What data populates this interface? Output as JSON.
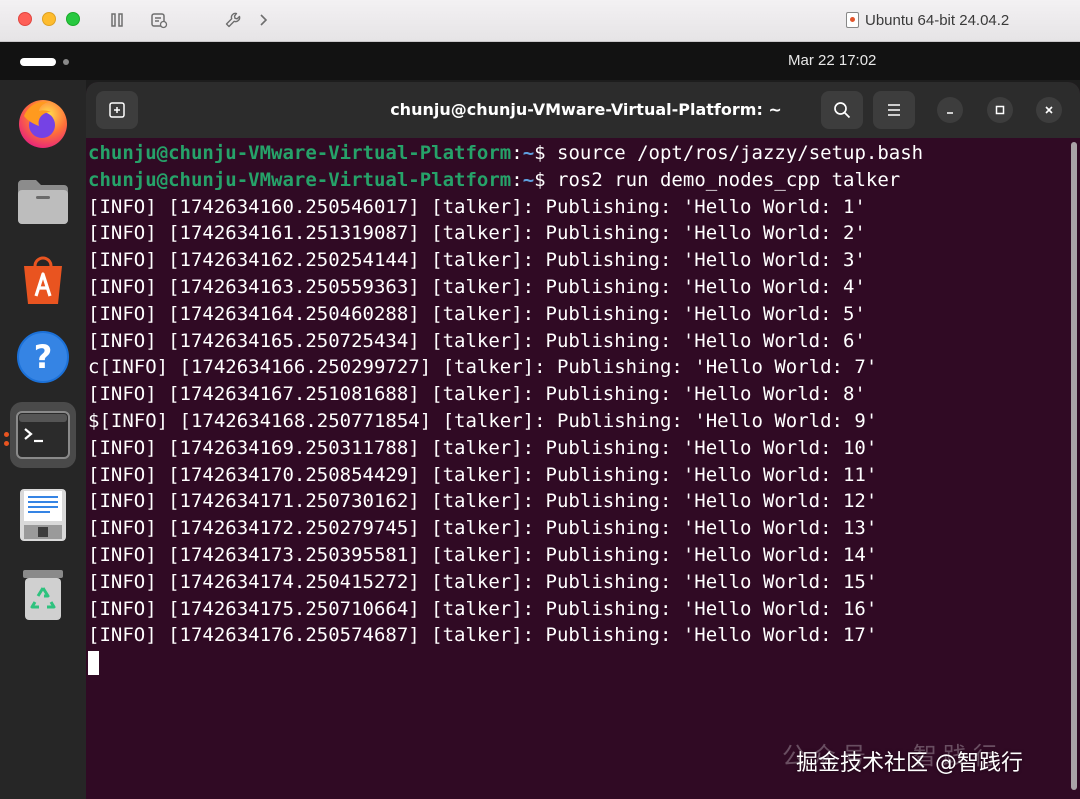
{
  "host": {
    "title": "Ubuntu 64-bit 24.04.2"
  },
  "topbar": {
    "clock": "Mar 22  17:02"
  },
  "terminal": {
    "title": "chunju@chunju-VMware-Virtual-Platform: ~",
    "prompt_user": "chunju@chunju-VMware-Virtual-Platform",
    "prompt_path": "~",
    "commands": [
      "source /opt/ros/jazzy/setup.bash",
      "ros2 run demo_nodes_cpp talker"
    ],
    "output": [
      "[INFO] [1742634160.250546017] [talker]: Publishing: 'Hello World: 1'",
      "[INFO] [1742634161.251319087] [talker]: Publishing: 'Hello World: 2'",
      "[INFO] [1742634162.250254144] [talker]: Publishing: 'Hello World: 3'",
      "[INFO] [1742634163.250559363] [talker]: Publishing: 'Hello World: 4'",
      "[INFO] [1742634164.250460288] [talker]: Publishing: 'Hello World: 5'",
      "[INFO] [1742634165.250725434] [talker]: Publishing: 'Hello World: 6'",
      "c[INFO] [1742634166.250299727] [talker]: Publishing: 'Hello World: 7'",
      "[INFO] [1742634167.251081688] [talker]: Publishing: 'Hello World: 8'",
      "$[INFO] [1742634168.250771854] [talker]: Publishing: 'Hello World: 9'",
      "[INFO] [1742634169.250311788] [talker]: Publishing: 'Hello World: 10'",
      "[INFO] [1742634170.250854429] [talker]: Publishing: 'Hello World: 11'",
      "[INFO] [1742634171.250730162] [talker]: Publishing: 'Hello World: 12'",
      "[INFO] [1742634172.250279745] [talker]: Publishing: 'Hello World: 13'",
      "[INFO] [1742634173.250395581] [talker]: Publishing: 'Hello World: 14'",
      "[INFO] [1742634174.250415272] [talker]: Publishing: 'Hello World: 15'",
      "[INFO] [1742634175.250710664] [talker]: Publishing: 'Hello World: 16'",
      "[INFO] [1742634176.250574687] [talker]: Publishing: 'Hello World: 17'"
    ]
  },
  "dock": {
    "items": [
      "firefox-icon",
      "files-icon",
      "app-center-icon",
      "help-icon",
      "terminal-icon",
      "text-editor-icon",
      "trash-icon"
    ]
  },
  "watermark": {
    "faint": "公众号 · 智践行",
    "text": "掘金技术社区 @智践行"
  },
  "colors": {
    "terminal_bg": "#300a24",
    "prompt_user": "#26a269",
    "prompt_path": "#5ea0e0",
    "header_bg": "#2c2c2c"
  }
}
